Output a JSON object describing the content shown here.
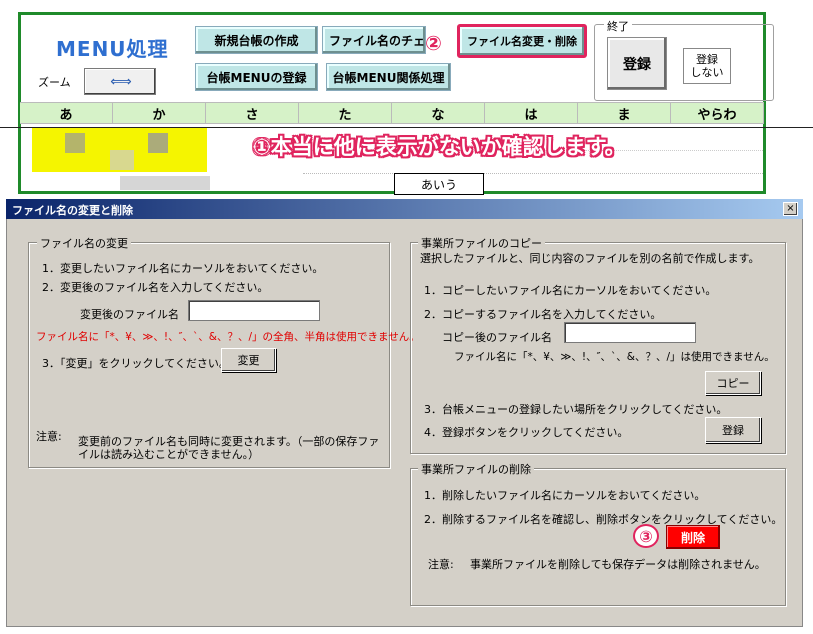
{
  "menu": {
    "title": "MENU処理",
    "zoom_label": "ズーム",
    "zoom_icon": "⇐⇒",
    "buttons": {
      "new_ledger": "新規台帳の作成",
      "filename_check": "ファイル名のチェ",
      "rename_delete": "ファイル名変更・削除",
      "ledger_menu_register": "台帳MENUの登録",
      "ledger_menu_related": "台帳MENU関係処理"
    },
    "end_group": {
      "label": "終了",
      "register": "登録",
      "no_register": "登録\nしない"
    },
    "kana_headers": [
      "あ",
      "か",
      "さ",
      "た",
      "な",
      "は",
      "ま",
      "やらわ"
    ],
    "cell_value": "あいう"
  },
  "annotations": {
    "note1": "①本当に他に表示がないか確認します。",
    "num2": "②",
    "num3": "③"
  },
  "dialog": {
    "title": "ファイル名の変更と削除",
    "close": "×",
    "rename": {
      "legend": "ファイル名の変更",
      "step1": "1．変更したいファイル名にカーソルをおいてください。",
      "step2": "2．変更後のファイル名を入力してください。",
      "field_label": "変更後のファイル名",
      "field_value": "",
      "warning": "ファイル名に「*、¥、≫、!、″、`、&、？、/」の全角、半角は使用できません。",
      "step3": "3．「変更」をクリックしてください。",
      "button": "変更",
      "note_label": "注意:",
      "note_line1": "変更前のファイル名も同時に変更されます。（一部の保存ファ",
      "note_line2": "イルは読み込むことができません。）"
    },
    "copy": {
      "legend": "事業所ファイルのコピー",
      "intro": "選択したファイルと、同じ内容のファイルを別の名前で作成します。",
      "step1": "1．コピーしたいファイル名にカーソルをおいてください。",
      "step2": "2．コピーするファイル名を入力してください。",
      "field_label": "コピー後のファイル名",
      "field_value": "",
      "warning": "ファイル名に「*、¥、≫、!、″、`、&、？、/」は使用できません。",
      "button": "コピー",
      "step3": "3．台帳メニューの登録したい場所をクリックしてください。",
      "step4": "4．登録ボタンをクリックしてください。",
      "register_button": "登録"
    },
    "delete": {
      "legend": "事業所ファイルの削除",
      "step1": "1．削除したいファイル名にカーソルをおいてください。",
      "step2": "2．削除するファイル名を確認し、削除ボタンをクリックしてください。",
      "button": "削除",
      "note_label": "注意:",
      "note_text": "事業所ファイルを削除しても保存データは削除されません。"
    }
  }
}
